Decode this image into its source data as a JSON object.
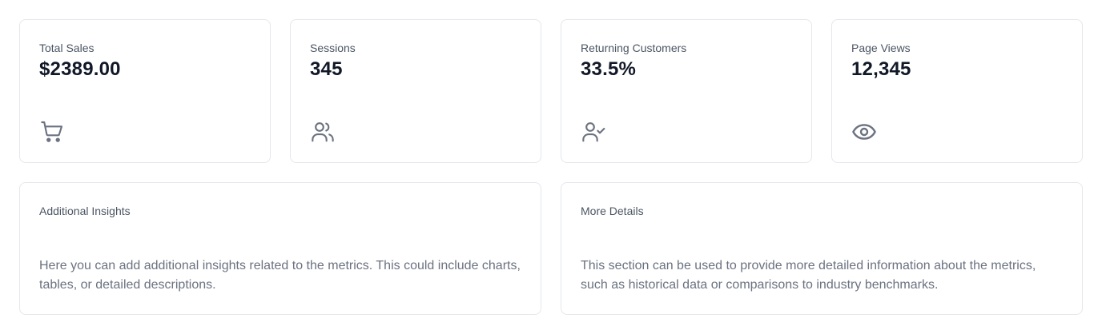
{
  "metrics": [
    {
      "label": "Total Sales",
      "value": "$2389.00",
      "icon": "shopping-cart-icon"
    },
    {
      "label": "Sessions",
      "value": "345",
      "icon": "users-icon"
    },
    {
      "label": "Returning Customers",
      "value": "33.5%",
      "icon": "user-check-icon"
    },
    {
      "label": "Page Views",
      "value": "12,345",
      "icon": "eye-icon"
    }
  ],
  "details": [
    {
      "title": "Additional Insights",
      "body": "Here you can add additional insights related to the metrics. This could include charts, tables, or detailed descriptions."
    },
    {
      "title": "More Details",
      "body": "This section can be used to provide more detailed information about the metrics, such as historical data or comparisons to industry benchmarks."
    }
  ],
  "colors": {
    "card_border": "#e5e7eb",
    "label": "#4b5563",
    "value": "#111827",
    "icon": "#6b7280",
    "body_text": "#6b7280"
  }
}
